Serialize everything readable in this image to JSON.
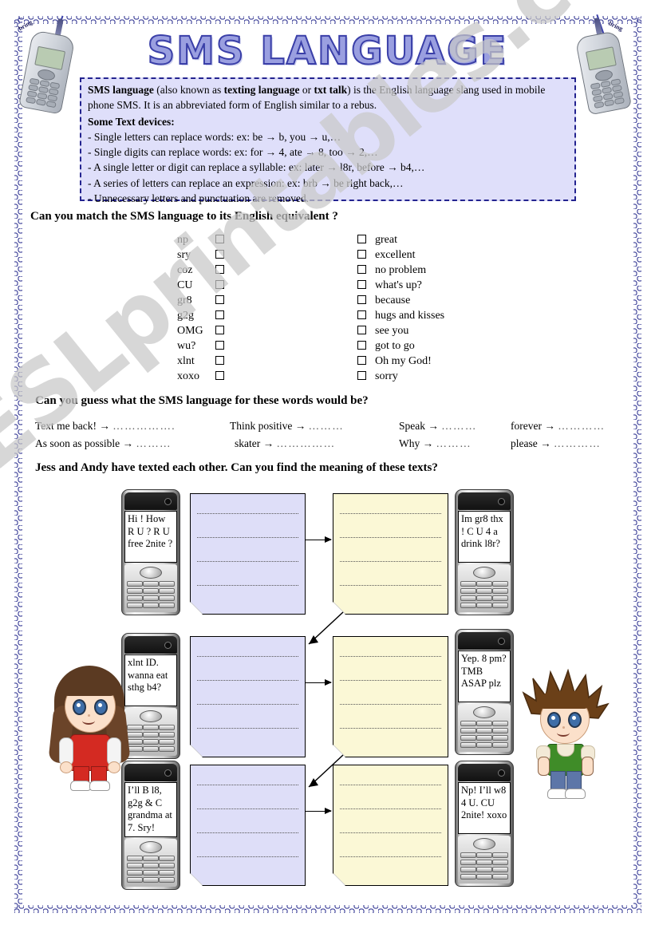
{
  "page": {
    "title": "SMS LANGUAGE",
    "watermark": "ESLprintables.com",
    "accent_blue": "#23238f",
    "note_blue": "#dedef8",
    "note_yellow": "#fbf8d6"
  },
  "corner_phones": {
    "left_brand": "bring",
    "right_brand": "bring"
  },
  "intro": {
    "line1_a": "SMS language",
    "line1_b": " (also known as ",
    "line1_c": "texting language",
    "line1_d": " or ",
    "line1_e": "txt talk",
    "line1_f": ") is the English language slang used in mobile phone SMS. It is an abbreviated form of English similar to a rebus.",
    "devices_heading": "Some Text devices:",
    "devices": [
      "- Single letters can replace words: ex: be → b, you → u,…",
      "- Single digits can replace words: ex: for → 4, ate → 8, too → 2,…",
      "- A single letter or digit can replace a syllable: ex: later → l8r, before → b4,…",
      "- A series of letters can replace an expression: ex: brb → be right back,…",
      "- Unnecessary letters and punctuation are removed."
    ]
  },
  "exercise1": {
    "heading": "Can you match the SMS language to its English equivalent ?",
    "sms_terms": [
      "np",
      "sry",
      "coz",
      "CU",
      "gr8",
      "g2g",
      "OMG",
      "wu?",
      "xlnt",
      "xoxo"
    ],
    "english_terms": [
      "great",
      "excellent",
      "no problem",
      "what's up?",
      "because",
      "hugs and kisses",
      "see you",
      "got to go",
      "Oh my God!",
      "sorry"
    ]
  },
  "exercise2": {
    "heading": "Can you guess what the SMS language for these words would be?",
    "columns": [
      {
        "rows": [
          {
            "prompt": "Text me back! →",
            "blank": "……………."
          },
          {
            "prompt": "As soon as possible →",
            "blank": "………"
          }
        ]
      },
      {
        "rows": [
          {
            "prompt": "Think positive →",
            "blank": "………"
          },
          {
            "prompt": "skater →",
            "blank": "……………"
          }
        ]
      },
      {
        "rows": [
          {
            "prompt": "Speak →",
            "blank": "………"
          },
          {
            "prompt": "Why →",
            "blank": "………"
          }
        ]
      },
      {
        "rows": [
          {
            "prompt": "forever →",
            "blank": "…………"
          },
          {
            "prompt": "please →",
            "blank": "…………"
          }
        ]
      }
    ]
  },
  "exercise3": {
    "heading": "Jess and Andy have texted each other. Can you find the meaning of these texts?",
    "conversation": [
      {
        "left_phone_text": "Hi ! How R U ? R U free 2nite ?",
        "right_phone_text": "Im  gr8 thx ! C U 4 a drink l8r?"
      },
      {
        "left_phone_text": "xlnt ID. wanna eat sthg b4?",
        "right_phone_text": "Yep. 8 pm? TMB ASAP plz"
      },
      {
        "left_phone_text": "I’ll B l8, g2g & C grandma at 7. Sry!",
        "right_phone_text": "Np! I’ll w8 4 U. CU 2nite! xoxo"
      }
    ]
  },
  "characters": {
    "girl_name": "Jess",
    "boy_name": "Andy"
  }
}
